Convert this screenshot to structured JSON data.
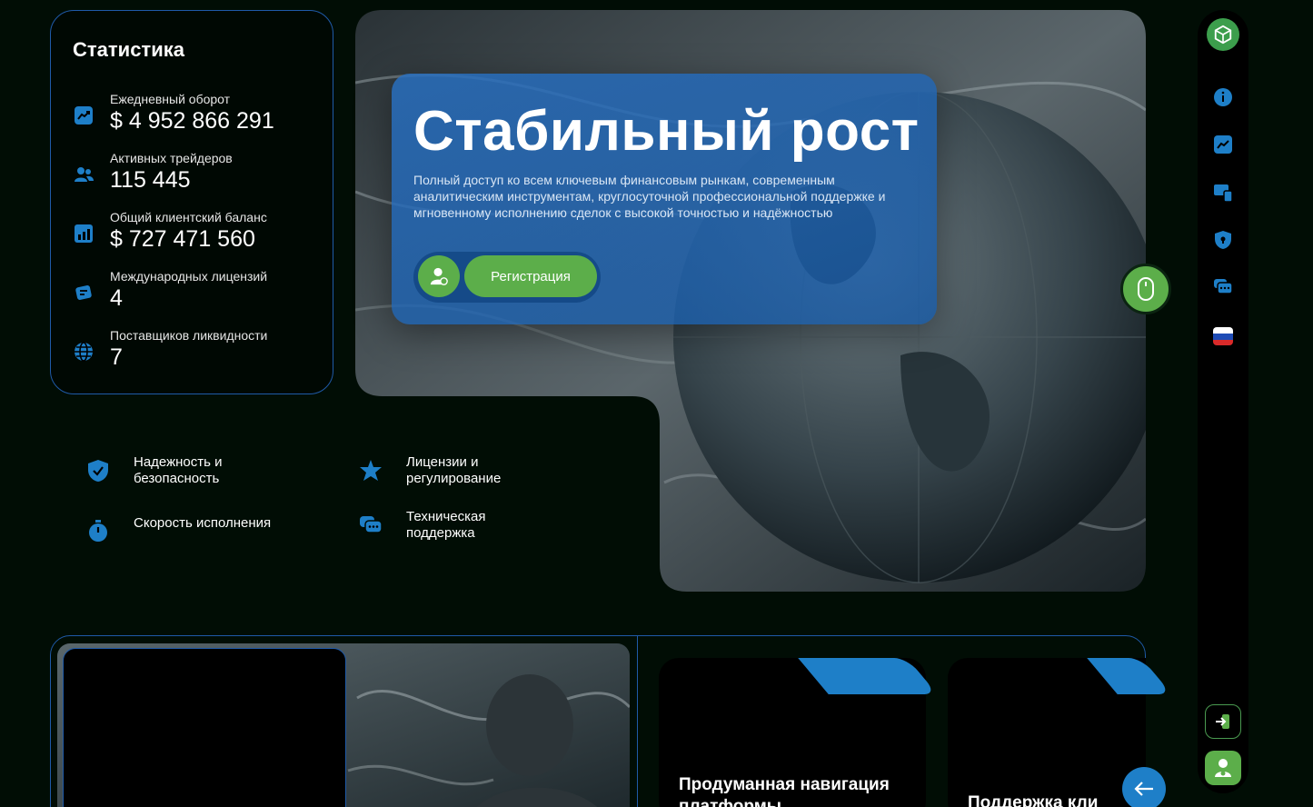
{
  "stats": {
    "title": "Статистика",
    "items": [
      {
        "label": "Ежедневный оборот",
        "value": "$ 4 952 866 291",
        "icon": "trend-up-icon"
      },
      {
        "label": "Активных трейдеров",
        "value": "115 445",
        "icon": "users-icon"
      },
      {
        "label": "Общий клиентский баланс",
        "value": "$ 727 471 560",
        "icon": "bar-chart-icon"
      },
      {
        "label": "Международных лицензий",
        "value": "4",
        "icon": "certificate-icon"
      },
      {
        "label": "Поставщиков ликвидности",
        "value": "7",
        "icon": "globe-icon"
      }
    ]
  },
  "hero": {
    "title": "Стабильный рост",
    "description": "Полный доступ ко всем ключевым финансовым рынкам, современным аналитическим инструментам, круглосуточной профессиональной поддержке и мгновенному исполнению сделок с высокой точностью и надёжностью",
    "register_label": "Регистрация"
  },
  "features": [
    {
      "text": "Надежность и безопасность",
      "icon": "shield-check-icon"
    },
    {
      "text": "Лицензии и регулирование",
      "icon": "star-badge-icon"
    },
    {
      "text": "Скорость исполнения",
      "icon": "stopwatch-icon"
    },
    {
      "text": "Техническая поддержка",
      "icon": "chat-bubbles-icon"
    }
  ],
  "cards": [
    {
      "title": "Продуманная навигация платформы"
    },
    {
      "title": "Поддержка кли"
    }
  ],
  "colors": {
    "background": "#010d05",
    "accent_blue": "#1e7fc8",
    "accent_green": "#5cae4a",
    "border_blue": "#1f5aa8"
  }
}
